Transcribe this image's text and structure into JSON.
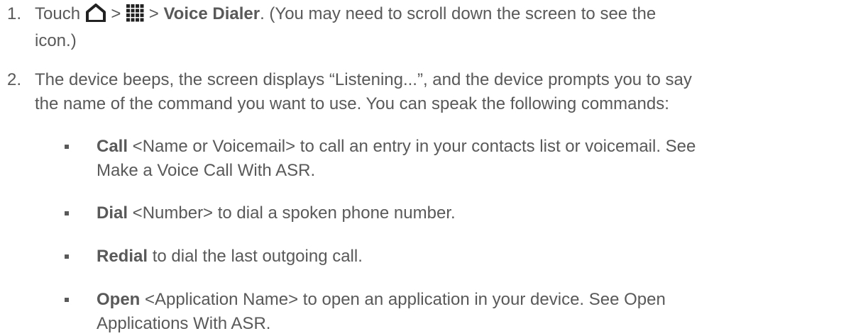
{
  "steps": [
    {
      "number": "1.",
      "prefix": "Touch",
      "sep1": ">",
      "sep2": ">",
      "target": "Voice Dialer",
      "suffix": ". (You may need to scroll down the screen to see the",
      "line2": "icon.)",
      "icons": [
        "home-icon",
        "apps-grid-icon"
      ]
    },
    {
      "number": "2.",
      "line1": "The device beeps, the screen displays “Listening...”, and the device prompts you to say",
      "line2": "the name of the command you want to use. You can speak the following commands:"
    }
  ],
  "commands": [
    {
      "keyword": "Call",
      "rest1": " <Name or Voicemail> to call an entry in your contacts list or voicemail. See",
      "line2": "Make a Voice Call With ASR."
    },
    {
      "keyword": "Dial",
      "rest1": " <Number> to dial a spoken phone number."
    },
    {
      "keyword": "Redial",
      "rest1": " to dial the last outgoing call."
    },
    {
      "keyword": "Open",
      "rest1": " <Application Name> to open an application in your device. See Open",
      "line2": "Applications With ASR."
    }
  ],
  "colors": {
    "text": "#595959",
    "icon": "#222222",
    "background": "#ffffff"
  }
}
